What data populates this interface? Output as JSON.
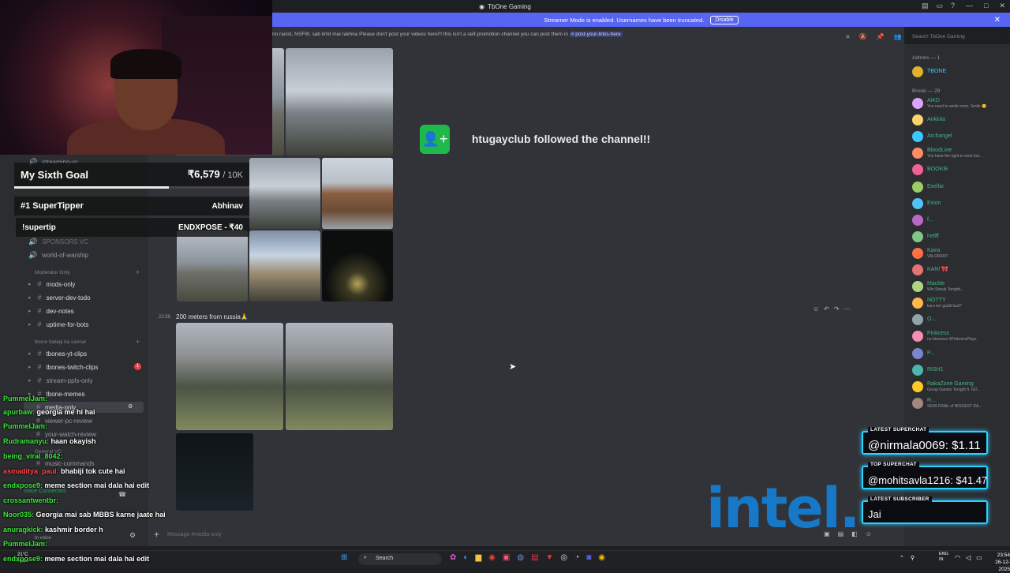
{
  "window": {
    "title": "TbOne Gaming"
  },
  "banner": {
    "text": "Streamer Mode is enabled. Usernames have been truncated.",
    "button": "Disable"
  },
  "channel": {
    "topic": "no racist, NSFW, sab limit mai rakhna Please don't post your videos here!!! this isn't a self-promotion channel you can post them in",
    "topic_link": "# post-your-links-here",
    "search_placeholder": "Search TbOne Gaming"
  },
  "sidebar": {
    "channels_top": [
      "streaming-vc",
      "SPONSORS VC",
      "world-of-warship"
    ],
    "moderator_category": "Moderator Only",
    "moderator_channels": [
      "mods-only",
      "server-dev-todo",
      "dev-notes",
      "uptime-for-bots"
    ],
    "babaji_category": "tbone babaji ka sansar",
    "babaji_channels": [
      "tbones-yt-clips",
      "tbones-twitch-clips",
      "stream-ppls-only",
      "tbone-memes",
      "media-only",
      "viewer-pc-review",
      "your-watch-review",
      "music-commands"
    ],
    "unread_badge": "1",
    "general_category": "General VC",
    "voice_status": "Voice Connected",
    "voice_sub": "In voice"
  },
  "messages": {
    "time": "22:59",
    "text": "200 meters from russia🙏",
    "composer_placeholder": "Message #media-only"
  },
  "members": {
    "admins_header": "Admins — 1",
    "admin": "TBONE",
    "broski_header": "Broski — 29",
    "list": [
      {
        "name": "AiKD",
        "status": "You need to smile more. Smile 😊"
      },
      {
        "name": "Ankkita",
        "status": ""
      },
      {
        "name": "Archangel",
        "status": ""
      },
      {
        "name": "BloodLine",
        "status": "You have the right to work but..."
      },
      {
        "name": "BOOKIE",
        "status": ""
      },
      {
        "name": "Exellar",
        "status": ""
      },
      {
        "name": "Exion",
        "status": ""
      },
      {
        "name": "f...",
        "status": ""
      },
      {
        "name": "hellff",
        "status": ""
      },
      {
        "name": "Kaira",
        "status": "VALORANT"
      },
      {
        "name": "KAN! 🎀",
        "status": ""
      },
      {
        "name": "Mackle",
        "status": "Win Streak Tonight..."
      },
      {
        "name": "NOTTY",
        "status": "karu teri guddi laal?"
      },
      {
        "name": "O...",
        "status": ""
      },
      {
        "name": "Pinkcess",
        "status": "no bloxxxxx #PinkcessPlays"
      },
      {
        "name": "P...",
        "status": ""
      },
      {
        "name": "RISH1",
        "status": ""
      },
      {
        "name": "RakaZone Gaming",
        "status": "Group Games Tonight ft. GO..."
      },
      {
        "name": "R...",
        "status": "SEMI-FINAL of BIGGEST RA..."
      }
    ]
  },
  "alert": {
    "text": "htugayclub followed the channel!!"
  },
  "overlay": {
    "goal_title": "My Sixth Goal",
    "goal_amount": "₹6,579",
    "goal_target": "/ 10K",
    "goal_progress": 0.658,
    "tipper_label": "#1 SuperTipper",
    "tipper_name": "Abhinav",
    "supertip_label": "!supertip",
    "supertip_value": "ENDXPOSE - ₹40"
  },
  "chat": [
    {
      "user": "PummelJam:",
      "msg": "",
      "style": "u"
    },
    {
      "user": "apurbaw:",
      "msg": "georgia me hi hai",
      "style": "u"
    },
    {
      "user": "PummelJam:",
      "msg": "",
      "style": "u"
    },
    {
      "user": "Rudramanyu:",
      "msg": "haan okayish",
      "style": "u"
    },
    {
      "user": "being_viral_8042:",
      "msg": "",
      "style": "u"
    },
    {
      "user": "asmaditya_paul:",
      "msg": "bhabiji tok cute hai",
      "style": "u2"
    },
    {
      "user": "endxpose9:",
      "msg": "meme section mai dala hai edit",
      "style": "u"
    },
    {
      "user": "crossantwentbr:",
      "msg": "",
      "style": "u"
    },
    {
      "user": "Noor035:",
      "msg": "Georgia mai sab MBBS karne jaate hai",
      "style": "u"
    },
    {
      "user": "anuragkick:",
      "msg": "kashmir border h",
      "style": "u"
    },
    {
      "user": "PummelJam:",
      "msg": "",
      "style": "u"
    },
    {
      "user": "endxpose9:",
      "msg": "meme section mai dala hai edit",
      "style": "u"
    }
  ],
  "supers": {
    "chat_label": "LATEST SUPERCHAT",
    "chat_value": "@nirmala0069: $1.11",
    "top_label": "TOP SUPERCHAT",
    "top_value": "@mohitsavla1216: $41.47",
    "sub_label": "LATEST SUBSCRIBER",
    "sub_value": "Jai"
  },
  "brand": {
    "logo_text": "intel."
  },
  "taskbar": {
    "search": "Search",
    "weather_temp": "21°C",
    "weather_desc": "Haze",
    "lang1": "ENG",
    "lang2": "IN",
    "time": "23:54",
    "date": "26-12-2025"
  },
  "colors": {
    "accent": "#5865f2",
    "follow_green": "#21b84b",
    "super_border": "#2ad3ff",
    "intel_blue": "#1778c8"
  }
}
